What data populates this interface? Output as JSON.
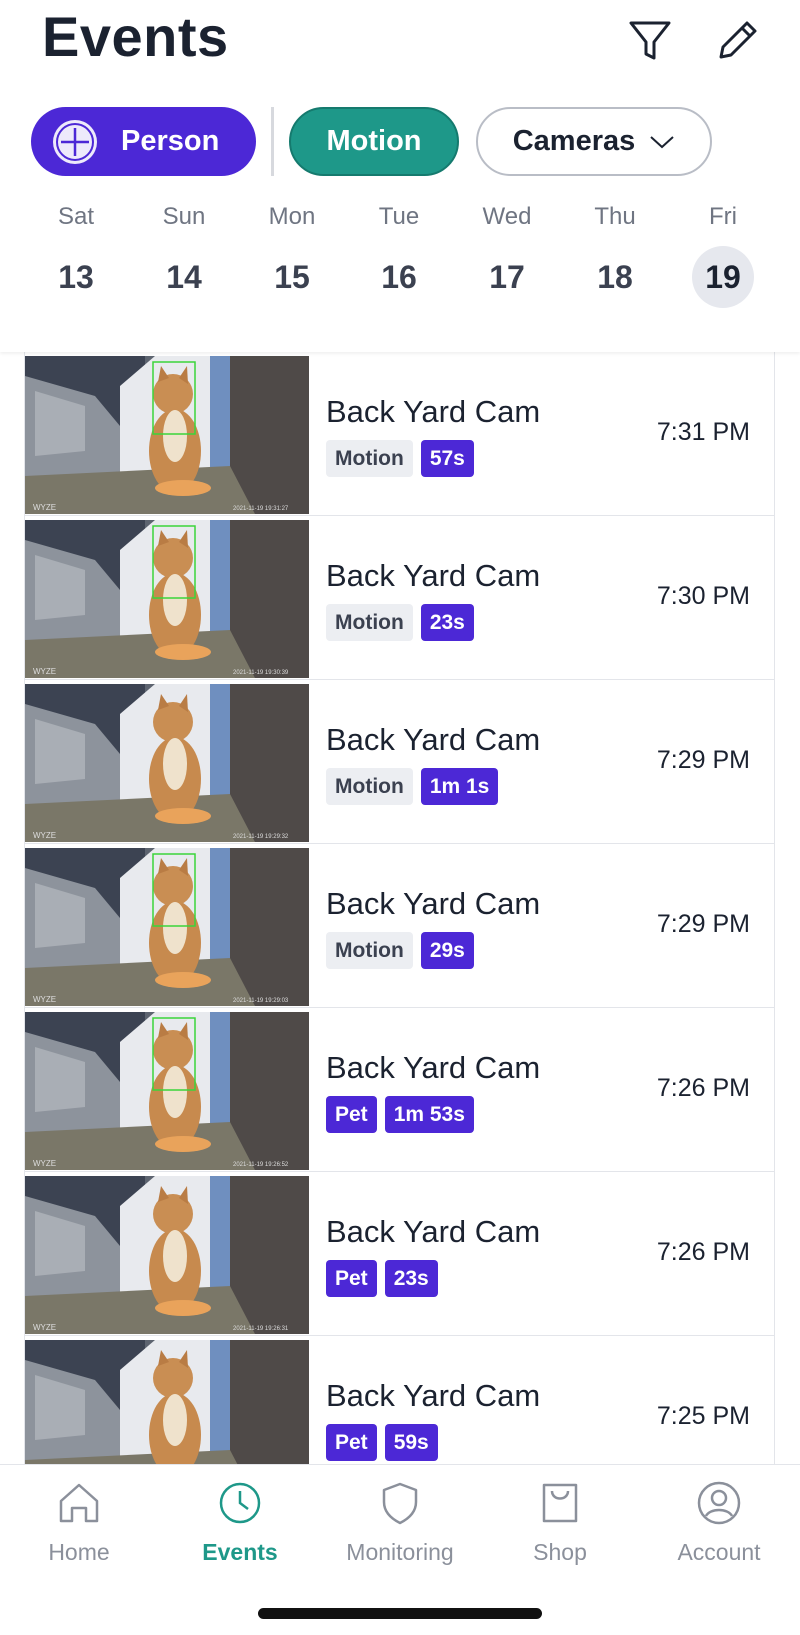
{
  "header": {
    "title": "Events"
  },
  "filters": {
    "person_label": "Person",
    "motion_label": "Motion",
    "cameras_label": "Cameras"
  },
  "days": [
    {
      "name": "Sat",
      "num": "13"
    },
    {
      "name": "Sun",
      "num": "14"
    },
    {
      "name": "Mon",
      "num": "15"
    },
    {
      "name": "Tue",
      "num": "16"
    },
    {
      "name": "Wed",
      "num": "17"
    },
    {
      "name": "Thu",
      "num": "18"
    },
    {
      "name": "Fri",
      "num": "19",
      "selected": true
    }
  ],
  "events": [
    {
      "camera": "Back Yard Cam",
      "type": "Motion",
      "duration": "57s",
      "time": "7:31 PM",
      "stamp": "2021-11-19 19:31:27",
      "box": true
    },
    {
      "camera": "Back Yard Cam",
      "type": "Motion",
      "duration": "23s",
      "time": "7:30 PM",
      "stamp": "2021-11-19 19:30:39",
      "box": true
    },
    {
      "camera": "Back Yard Cam",
      "type": "Motion",
      "duration": "1m 1s",
      "time": "7:29 PM",
      "stamp": "2021-11-19 19:29:32",
      "box": false
    },
    {
      "camera": "Back Yard Cam",
      "type": "Motion",
      "duration": "29s",
      "time": "7:29 PM",
      "stamp": "2021-11-19 19:29:03",
      "box": true
    },
    {
      "camera": "Back Yard Cam",
      "type": "Pet",
      "duration": "1m 53s",
      "time": "7:26 PM",
      "stamp": "2021-11-19 19:26:52",
      "box": true
    },
    {
      "camera": "Back Yard Cam",
      "type": "Pet",
      "duration": "23s",
      "time": "7:26 PM",
      "stamp": "2021-11-19 19:26:31",
      "box": false
    },
    {
      "camera": "Back Yard Cam",
      "type": "Pet",
      "duration": "59s",
      "time": "7:25 PM",
      "stamp": "",
      "box": false
    }
  ],
  "thumb_watermark": "WYZE",
  "nav": {
    "home": "Home",
    "events": "Events",
    "monitoring": "Monitoring",
    "shop": "Shop",
    "account": "Account"
  },
  "colors": {
    "accent_purple": "#4c28d6",
    "accent_teal": "#1e9889"
  }
}
